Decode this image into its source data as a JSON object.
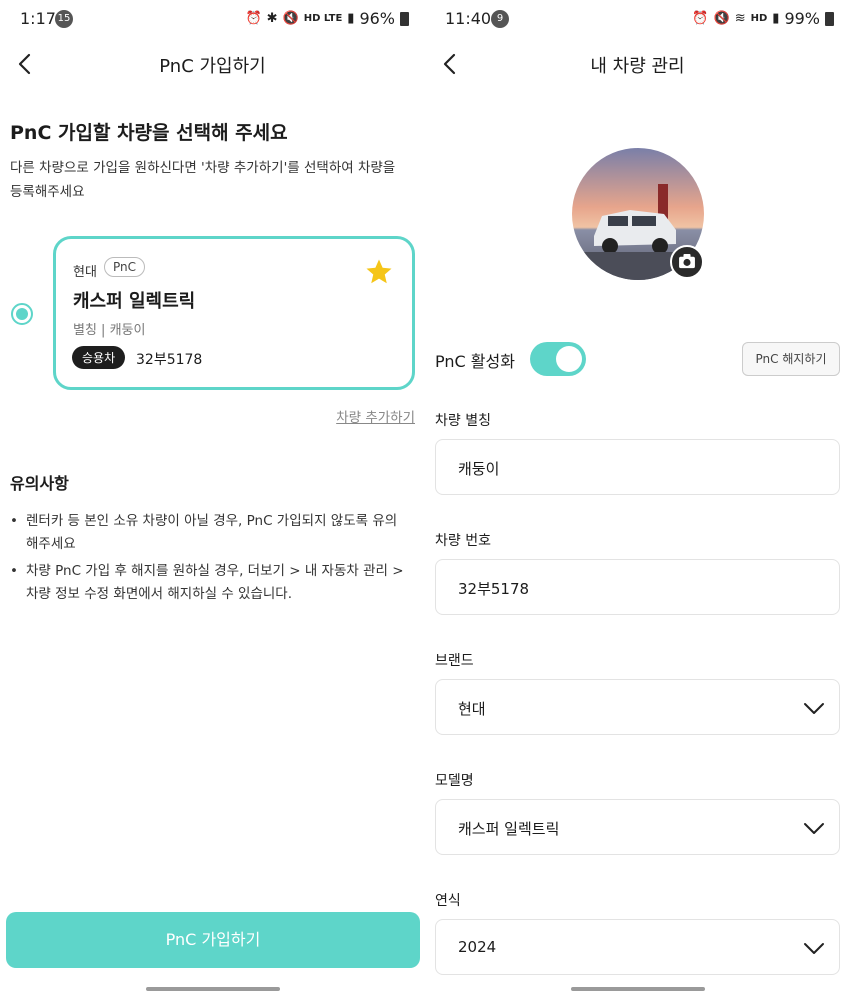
{
  "left": {
    "status": {
      "time": "1:17",
      "notification_count": "15",
      "battery": "96%",
      "network": "HD LTE"
    },
    "app_bar": {
      "title": "PnC 가입하기"
    },
    "heading": "PnC 가입할 차량을 선택해 주세요",
    "description": "다른 차량으로 가입을 원하신다면 '차량 추가하기'를 선택하여 차량을 등록해주세요",
    "vehicle_card": {
      "brand": "현대",
      "tag": "PnC",
      "model": "캐스퍼 일렉트릭",
      "nickname_line": "별칭 | 캐둥이",
      "type_badge": "승용차",
      "plate": "32부5178",
      "selected": true,
      "favorite": true
    },
    "add_vehicle_link": "차량 추가하기",
    "notice": {
      "title": "유의사항",
      "items": [
        "렌터카 등 본인 소유 차량이 아닐 경우, PnC 가입되지 않도록 유의해주세요",
        "차량 PnC 가입 후 해지를 원하실 경우, 더보기 > 내 자동차 관리 > 차량 정보 수정 화면에서 해지하실 수 있습니다."
      ]
    },
    "primary_button": "PnC 가입하기"
  },
  "right": {
    "status": {
      "time": "11:40",
      "notification_count": "9",
      "battery": "99%",
      "network": "HD"
    },
    "app_bar": {
      "title": "내 차량 관리"
    },
    "pnc_toggle": {
      "label": "PnC 활성화",
      "on": true
    },
    "cancel_button": "PnC 해지하기",
    "fields": {
      "nickname": {
        "label": "차량 별칭",
        "value": "캐둥이"
      },
      "plate": {
        "label": "차량 번호",
        "value": "32부5178"
      },
      "brand": {
        "label": "브랜드",
        "value": "현대"
      },
      "model": {
        "label": "모델명",
        "value": "캐스퍼 일렉트릭"
      },
      "year": {
        "label": "연식",
        "value": "2024"
      }
    }
  },
  "colors": {
    "accent": "#5ed5c9",
    "badge": "#1e1e1e",
    "star": "#f5c518"
  }
}
